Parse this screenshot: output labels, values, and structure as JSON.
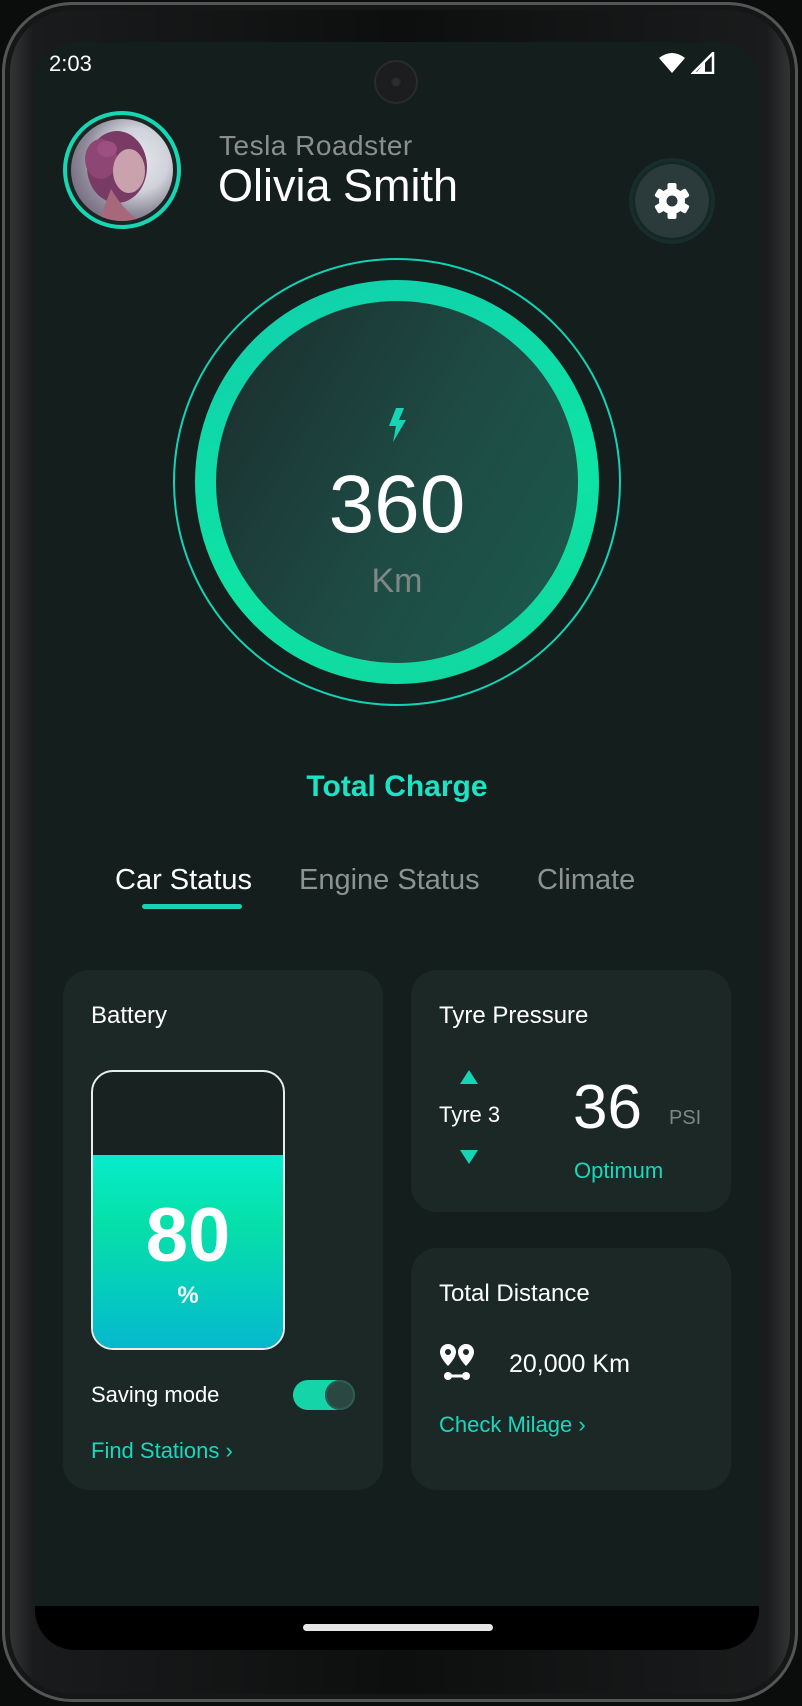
{
  "status_bar": {
    "time": "2:03"
  },
  "header": {
    "car_model": "Tesla Roadster",
    "user_name": "Olivia Smith"
  },
  "range": {
    "value": "360",
    "unit": "Km",
    "caption": "Total Charge"
  },
  "tabs": [
    {
      "label": "Car Status",
      "active": true
    },
    {
      "label": "Engine Status",
      "active": false
    },
    {
      "label": "Climate",
      "active": false
    }
  ],
  "battery_card": {
    "title": "Battery",
    "level_value": "80",
    "level_sign": "%",
    "fill_fraction": 0.7,
    "saving_mode_label": "Saving mode",
    "saving_mode_on": true,
    "find_stations_link": "Find Stations ›"
  },
  "tyre_card": {
    "title": "Tyre Pressure",
    "tyre_label": "Tyre 3",
    "pressure_value": "36",
    "pressure_unit": "PSI",
    "status": "Optimum"
  },
  "distance_card": {
    "title": "Total Distance",
    "distance_value": "20,000 Km",
    "check_link": "Check Milage ›"
  },
  "colors": {
    "accent": "#17d4b6",
    "background": "#141e1c",
    "card": "#1b2826"
  }
}
